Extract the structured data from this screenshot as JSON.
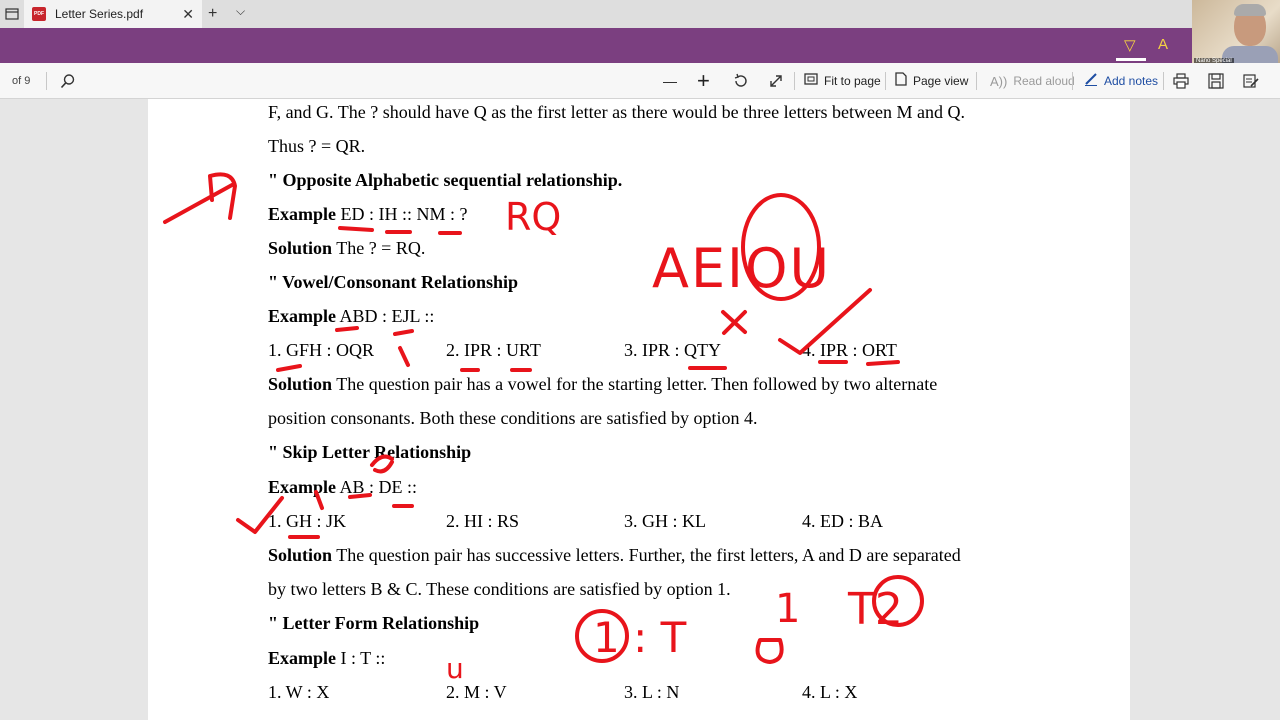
{
  "browser": {
    "tab_title": "Letter Series.pdf",
    "new_tab": "+",
    "close": "✕",
    "tab_list": "⌵"
  },
  "webcam": {
    "label": "Nano Special"
  },
  "toolbar": {
    "page_count": "of 9",
    "zoom_out": "—",
    "zoom_in": "+",
    "fit_to_page": "Fit to page",
    "page_view": "Page view",
    "read_aloud": "Read aloud",
    "add_notes": "Add notes"
  },
  "document": {
    "l1": "F, and G. The ? should have Q as the first letter as there would be three letters between M and Q.",
    "l2": "Thus ? = QR.",
    "s1_head": "\" Opposite Alphabetic sequential relationship.",
    "s1_ex_label": "Example",
    "s1_ex_text": " ED : IH :: NM : ?",
    "s1_sol_label": "Solution",
    "s1_sol_text": " The ? = RQ.",
    "s2_head": "\" Vowel/Consonant Relationship",
    "s2_ex_label": "Example",
    "s2_ex_text": " ABD : EJL ::",
    "s2_opts": [
      "1. GFH : OQR",
      "2. IPR : URT",
      "3. IPR : QTY",
      "4. IPR : ORT"
    ],
    "s2_sol_label": "Solution",
    "s2_sol_text": " The question pair has a vowel for the starting letter. Then followed by two alternate",
    "s2_sol_text2": "position consonants. Both these conditions are satisfied by option 4.",
    "s3_head": "\" Skip Letter Relationship",
    "s3_ex_label": "Example",
    "s3_ex_text": " AB : DE ::",
    "s3_opts": [
      "1. GH : JK",
      "2. HI : RS",
      "3. GH : KL",
      "4. ED : BA"
    ],
    "s3_sol_label": "Solution",
    "s3_sol_text": " The question pair has successive letters. Further, the first letters, A and D are separated",
    "s3_sol_text2": "by two letters B & C. These conditions are satisfied by option 1.",
    "s4_head": "\" Letter Form Relationship",
    "s4_ex_label": "Example",
    "s4_ex_text": " I : T ::",
    "s4_opts": [
      "1. W : X",
      "2. M : V",
      "3. L : N",
      "4. L : X"
    ]
  },
  "ink": {
    "color": "#e8141b",
    "notes": [
      "RQ",
      "AEIOU",
      "u",
      "1 : T",
      "1",
      "T2"
    ]
  }
}
